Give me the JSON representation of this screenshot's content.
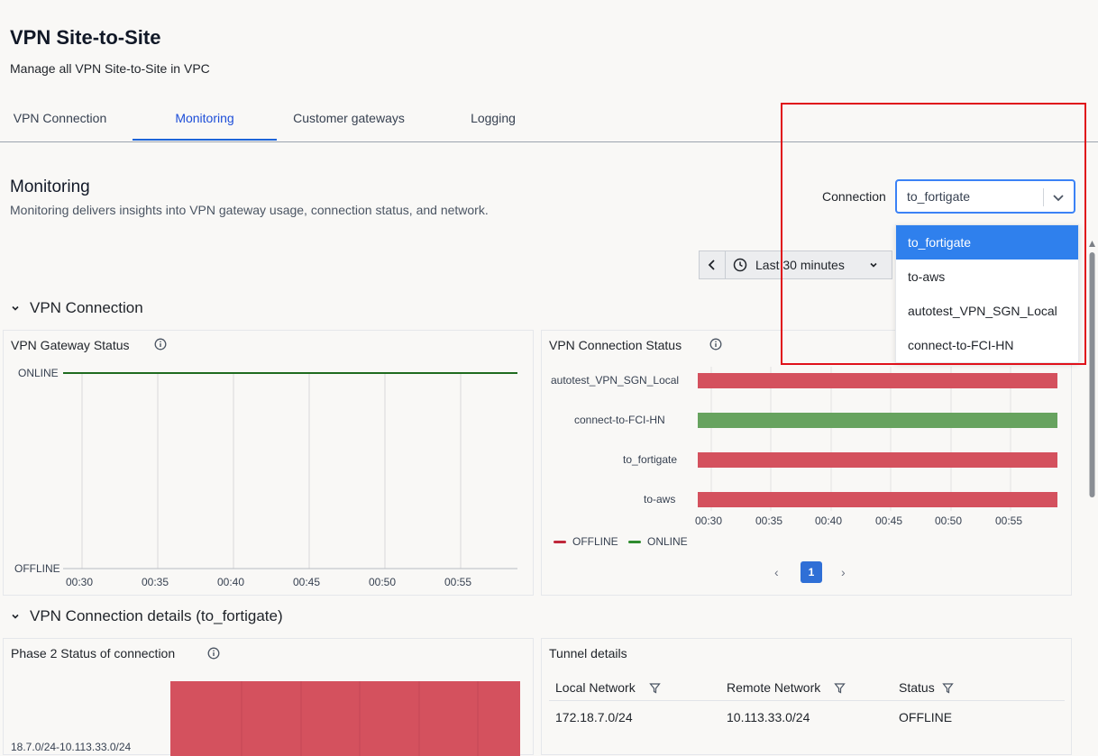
{
  "header": {
    "title": "VPN Site-to-Site",
    "subtitle": "Manage all VPN Site-to-Site in VPC"
  },
  "tabs": [
    {
      "label": "VPN Connection",
      "active": false
    },
    {
      "label": "Monitoring",
      "active": true
    },
    {
      "label": "Customer gateways",
      "active": false
    },
    {
      "label": "Logging",
      "active": false
    }
  ],
  "monitoring": {
    "title": "Monitoring",
    "description": "Monitoring delivers insights into VPN gateway usage, connection status, and network."
  },
  "connection_select": {
    "label": "Connection",
    "value": "to_fortigate",
    "options": [
      "to_fortigate",
      "to-aws",
      "autotest_VPN_SGN_Local",
      "connect-to-FCI-HN"
    ],
    "selected_index": 0
  },
  "time_range": {
    "label": "Last 30 minutes"
  },
  "vpn_connection_group": {
    "title": "VPN Connection"
  },
  "gateway_status_panel": {
    "title": "VPN Gateway Status",
    "y_labels": [
      "ONLINE",
      "OFFLINE"
    ],
    "x_labels": [
      "00:30",
      "00:35",
      "00:40",
      "00:45",
      "00:50",
      "00:55"
    ]
  },
  "connection_status_panel": {
    "title": "VPN Connection Status",
    "rows": [
      {
        "name": "autotest_VPN_SGN_Local",
        "status": "OFFLINE"
      },
      {
        "name": "connect-to-FCI-HN",
        "status": "ONLINE"
      },
      {
        "name": "to_fortigate",
        "status": "OFFLINE"
      },
      {
        "name": "to-aws",
        "status": "OFFLINE"
      }
    ],
    "x_labels": [
      "00:30",
      "00:35",
      "00:40",
      "00:45",
      "00:50",
      "00:55"
    ],
    "legend": [
      {
        "label": "OFFLINE",
        "color": "#c0283a"
      },
      {
        "label": "ONLINE",
        "color": "#2e8b2e"
      }
    ],
    "page": "1"
  },
  "details_group": {
    "title": "VPN Connection details (to_fortigate)"
  },
  "phase2_panel": {
    "title": "Phase 2 Status of connection",
    "row_label": "18.7.0/24-10.113.33.0/24"
  },
  "tunnel_panel": {
    "title": "Tunnel details",
    "columns": [
      "Local Network",
      "Remote Network",
      "Status"
    ],
    "rows": [
      [
        "172.18.7.0/24",
        "10.113.33.0/24",
        "OFFLINE"
      ]
    ]
  },
  "colors": {
    "accent": "#2f80ed",
    "offline": "#d4515e",
    "online": "#67a35f",
    "highlight_box": "#e0101a"
  }
}
